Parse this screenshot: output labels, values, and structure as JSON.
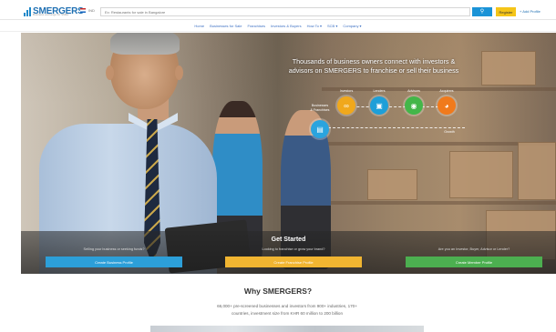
{
  "header": {
    "logo_text": "SMERGERS",
    "logo_sub": "Business exchange for SMEs",
    "country": "IND",
    "search_placeholder": "Ex: Restaurants for sale in Bangalore",
    "search_icon": "search-icon",
    "register_label": "Register",
    "login_label": "+ Add Profile",
    "brand_color": "#1e6fb2"
  },
  "nav": {
    "items": [
      "Home",
      "Businesses for Sale",
      "Franchises",
      "Investors & Buyers",
      "How To ▾",
      "SCB ▾",
      "Company ▾"
    ]
  },
  "hero": {
    "headline_line1": "Thousands of business owners connect with investors &",
    "headline_line2": "advisors on SMERGERS to franchise or sell their business",
    "nodes": [
      {
        "label": "Investors",
        "color": "#f0a81c",
        "icon": "handshake-icon",
        "glyph": "∞"
      },
      {
        "label": "Lenders",
        "color": "#1e9fd8",
        "icon": "bank-icon",
        "glyph": "▣"
      },
      {
        "label": "Advisors",
        "color": "#43b649",
        "icon": "advisor-icon",
        "glyph": "◉"
      },
      {
        "label": "Acquirers",
        "color": "#f07a1c",
        "icon": "acquirer-icon",
        "glyph": "◕"
      }
    ],
    "source_node": {
      "label": "Businesses\n& Franchises",
      "color": "#2aa4de",
      "icon": "business-icon",
      "glyph": "▤"
    },
    "growth_label": "Growth"
  },
  "get_started": {
    "title": "Get Started",
    "options": [
      {
        "question": "Selling your business or seeking funds?",
        "button": "Create Business Profile",
        "color": "#2c9fd9"
      },
      {
        "question": "Looking to franchise or grow your brand?",
        "button": "Create Franchise Profile",
        "color": "#f1b531"
      },
      {
        "question": "Are you an Investor, Buyer, Advisor or Lender?",
        "button": "Create Member Profile",
        "color": "#4caf50"
      }
    ]
  },
  "why": {
    "title": "Why SMERGERS?",
    "line1": "66,000+ pre-screened businesses and investors from 900+ industries, 170+",
    "line2": "countries, investment size from KHR 60 million to 200 billion"
  }
}
